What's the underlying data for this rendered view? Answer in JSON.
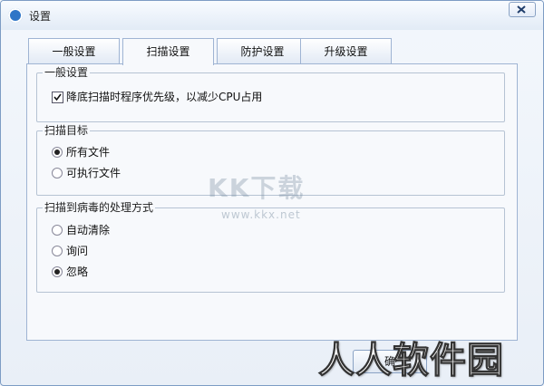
{
  "window": {
    "title": "设置"
  },
  "tabs": [
    {
      "label": "一般设置",
      "active": false
    },
    {
      "label": "扫描设置",
      "active": true
    },
    {
      "label": "防护设置",
      "active": false
    },
    {
      "label": "升级设置",
      "active": false
    }
  ],
  "groups": {
    "general": {
      "label": "一般设置",
      "options": [
        {
          "label": "降底扫描时程序优先级，以减少CPU占用",
          "checked": true
        }
      ]
    },
    "target": {
      "label": "扫描目标",
      "options": [
        {
          "label": "所有文件",
          "selected": true
        },
        {
          "label": "可执行文件",
          "selected": false
        }
      ]
    },
    "virus_action": {
      "label": "扫描到病毒的处理方式",
      "options": [
        {
          "label": "自动清除",
          "selected": false
        },
        {
          "label": "询问",
          "selected": false
        },
        {
          "label": "忽略",
          "selected": true
        }
      ]
    }
  },
  "watermark": {
    "logo": "KK下载",
    "url": "www.kkx.net"
  },
  "footer": {
    "ok_label": "确"
  },
  "overlay": {
    "brand": "人人软件园"
  },
  "icons": {
    "app": "app-icon",
    "close": "close-icon"
  },
  "colors": {
    "border": "#9fb4d3",
    "accent": "#2f76c7"
  }
}
